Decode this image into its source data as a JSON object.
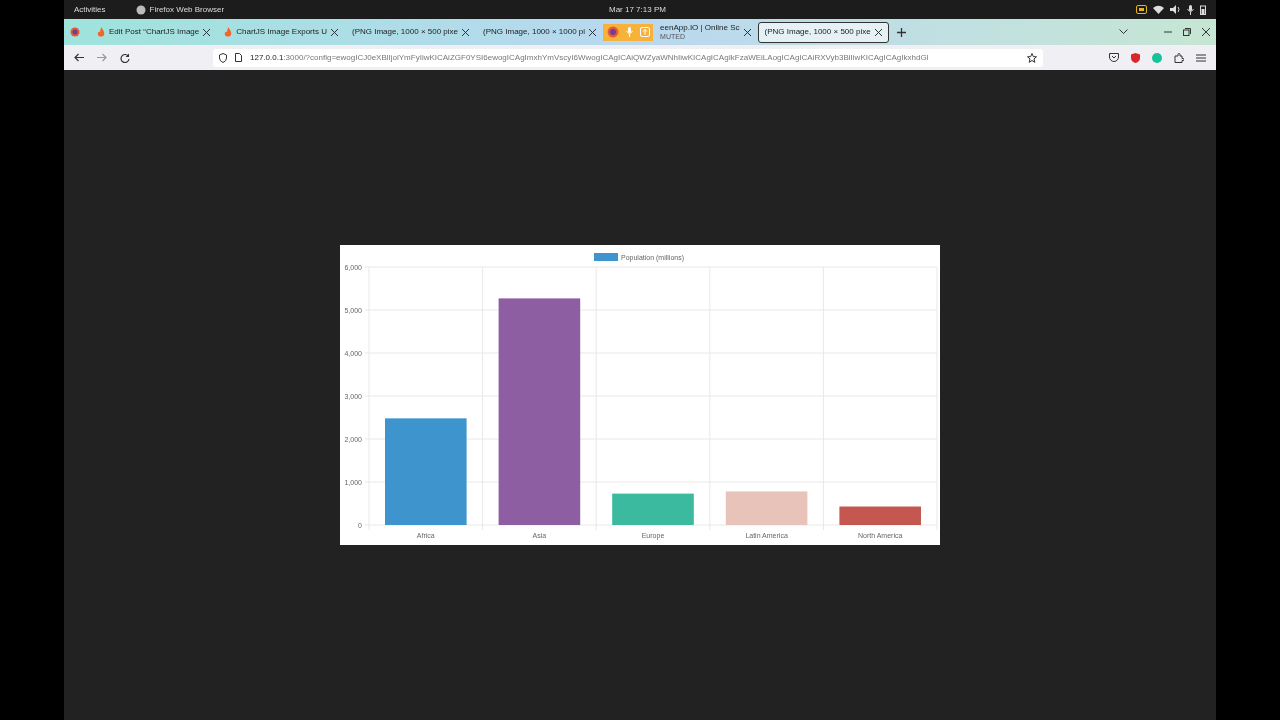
{
  "top_bar": {
    "activities": "Activities",
    "app_name": "Firefox Web Browser",
    "clock": "Mar 17  7:13 PM"
  },
  "tabs": [
    {
      "title": "Edit Post “ChartJS Image",
      "kind": "flame",
      "selected": false
    },
    {
      "title": "ChartJS Image Exports U",
      "kind": "flame",
      "selected": false
    },
    {
      "title": "(PNG Image, 1000 × 500 pixe",
      "kind": "plain",
      "selected": false
    },
    {
      "title": "(PNG Image, 1000 × 1000 pi",
      "kind": "plain",
      "selected": false
    },
    {
      "title": "eenApp.IO | Online Sc",
      "subtitle": "MUTED",
      "kind": "plain",
      "selected": false
    },
    {
      "title": "(PNG Image, 1000 × 500 pixe",
      "kind": "plain",
      "selected": true
    }
  ],
  "address_bar": {
    "host": "127.0.0.1",
    "rest": ":3000/?config=ewogICJ0eXBlIjoiYmFyIiwKICAiZGF0YSI6ewogICAgImxhYmVscyI6WwogICAgICAiQWZyaWNhIiwKICAgICAgIkFzaWEiLAogICAgICAiRXVyb3BlIiwKICAgICAgIkxhdGl"
  },
  "chart": {
    "chart_data": {
      "type": "bar",
      "grid": true,
      "categories": [
        "Africa",
        "Asia",
        "Europe",
        "Latin America",
        "North America"
      ],
      "series": [
        {
          "name": "Population (millions)",
          "color": "#3e95cd",
          "colors": [
            "#3e95cd",
            "#8e5ea2",
            "#3cba9f",
            "#e8c3b9",
            "#c45850"
          ],
          "values": [
            2480,
            5270,
            730,
            780,
            430
          ]
        }
      ],
      "ylim": [
        0,
        6000
      ],
      "yticks": [
        {
          "value": 0,
          "label": "0"
        },
        {
          "value": 1000,
          "label": "1,000"
        },
        {
          "value": 2000,
          "label": "2,000"
        },
        {
          "value": 3000,
          "label": "3,000"
        },
        {
          "value": 4000,
          "label": "4,000"
        },
        {
          "value": 5000,
          "label": "5,000"
        },
        {
          "value": 6000,
          "label": "6,000"
        }
      ]
    }
  }
}
